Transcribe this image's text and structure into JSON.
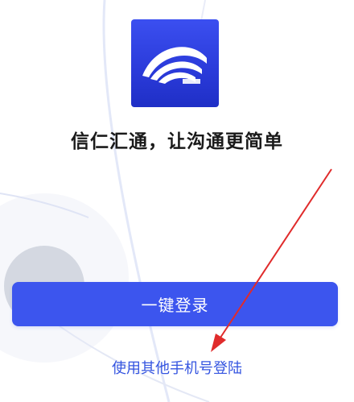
{
  "app": {
    "logo_icon": "xinren-huitong-wave-logo",
    "slogan": "信仁汇通，让沟通更简单"
  },
  "actions": {
    "one_click_login_label": "一键登录",
    "other_phone_login_label": "使用其他手机号登陆"
  },
  "colors": {
    "primary": "#3c55ee",
    "link": "#3454e0",
    "annotation_arrow": "#e02b2b"
  }
}
